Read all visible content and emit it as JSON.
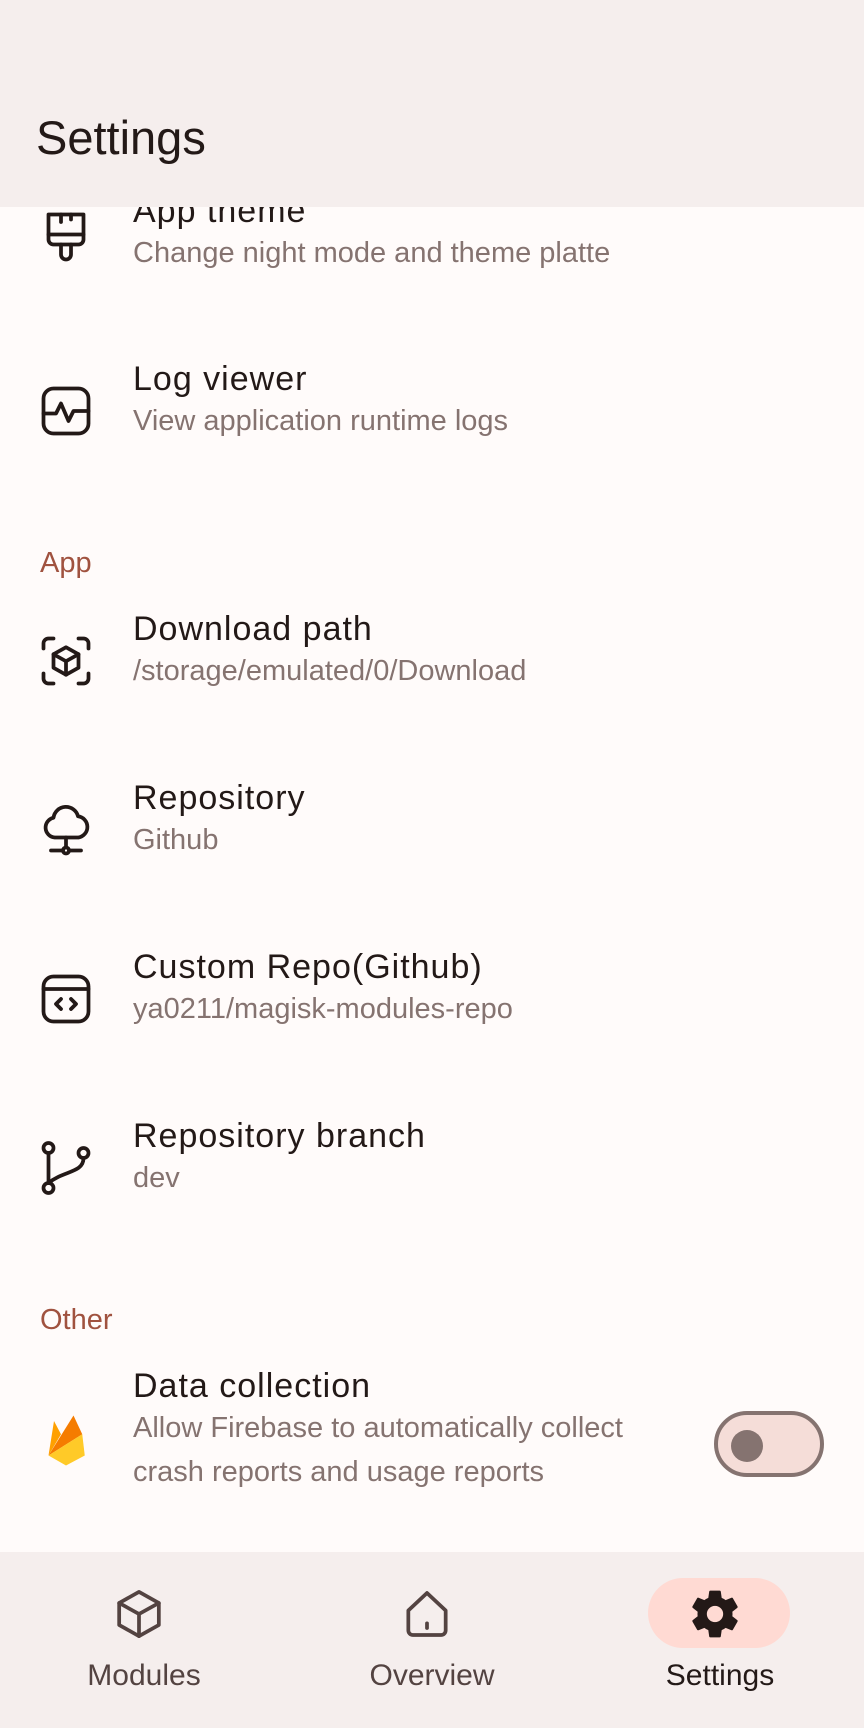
{
  "header": {
    "title": "Settings"
  },
  "items": [
    {
      "title": "App theme",
      "subtitle": "Change night mode and theme platte",
      "icon": "paintbrush-icon"
    },
    {
      "title": "Log viewer",
      "subtitle": "View application runtime logs",
      "icon": "activity-monitor-icon"
    }
  ],
  "sections": {
    "app": {
      "header": "App",
      "items": [
        {
          "title": "Download path",
          "subtitle": "/storage/emulated/0/Download",
          "icon": "box-folder-icon"
        },
        {
          "title": "Repository",
          "subtitle": "Github",
          "icon": "cloud-network-icon"
        },
        {
          "title": "Custom Repo(Github)",
          "subtitle": "ya0211/magisk-modules-repo",
          "icon": "code-window-icon"
        },
        {
          "title": "Repository branch",
          "subtitle": "dev",
          "icon": "git-branch-icon"
        }
      ]
    },
    "other": {
      "header": "Other",
      "items": [
        {
          "title": "Data collection",
          "subtitle": "Allow Firebase to automatically collect crash reports and usage reports",
          "icon": "firebase-icon",
          "toggle": false
        }
      ]
    }
  },
  "nav": [
    {
      "label": "Modules",
      "icon": "cube-icon",
      "active": false
    },
    {
      "label": "Overview",
      "icon": "home-icon",
      "active": false
    },
    {
      "label": "Settings",
      "icon": "gear-icon",
      "active": true
    }
  ],
  "colors": {
    "accent": "#a0523f",
    "surface": "#fffbfa",
    "topbar": "#f5eeed",
    "active_pill": "#ffdad3",
    "text_primary": "#231917",
    "text_secondary": "#857370",
    "firebase_yellow": "#ffca28",
    "firebase_orange": "#f57c00"
  }
}
